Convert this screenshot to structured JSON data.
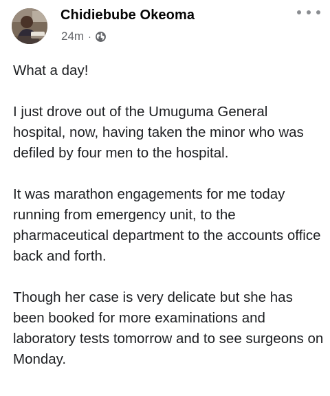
{
  "post": {
    "author_name": "Chidiebube Okeoma",
    "timestamp": "24m",
    "separator": "·",
    "privacy_icon": "globe-icon",
    "more_icon": "more-options-icon",
    "paragraphs": [
      "What a day!",
      "I just drove out of the Umuguma General hospital, now, having taken the minor who was defiled by four men to the hospital.",
      "It was marathon engagements for me today running from emergency unit, to the pharmaceutical department to the accounts office back and forth.",
      "Though her case is very delicate but she has been booked for more examinations and laboratory tests tomorrow and to see surgeons on Monday."
    ]
  },
  "colors": {
    "author_text": "#050505",
    "meta_text": "#65676b",
    "body_text": "#1c1e21",
    "icon_gray": "#8a8d91"
  }
}
